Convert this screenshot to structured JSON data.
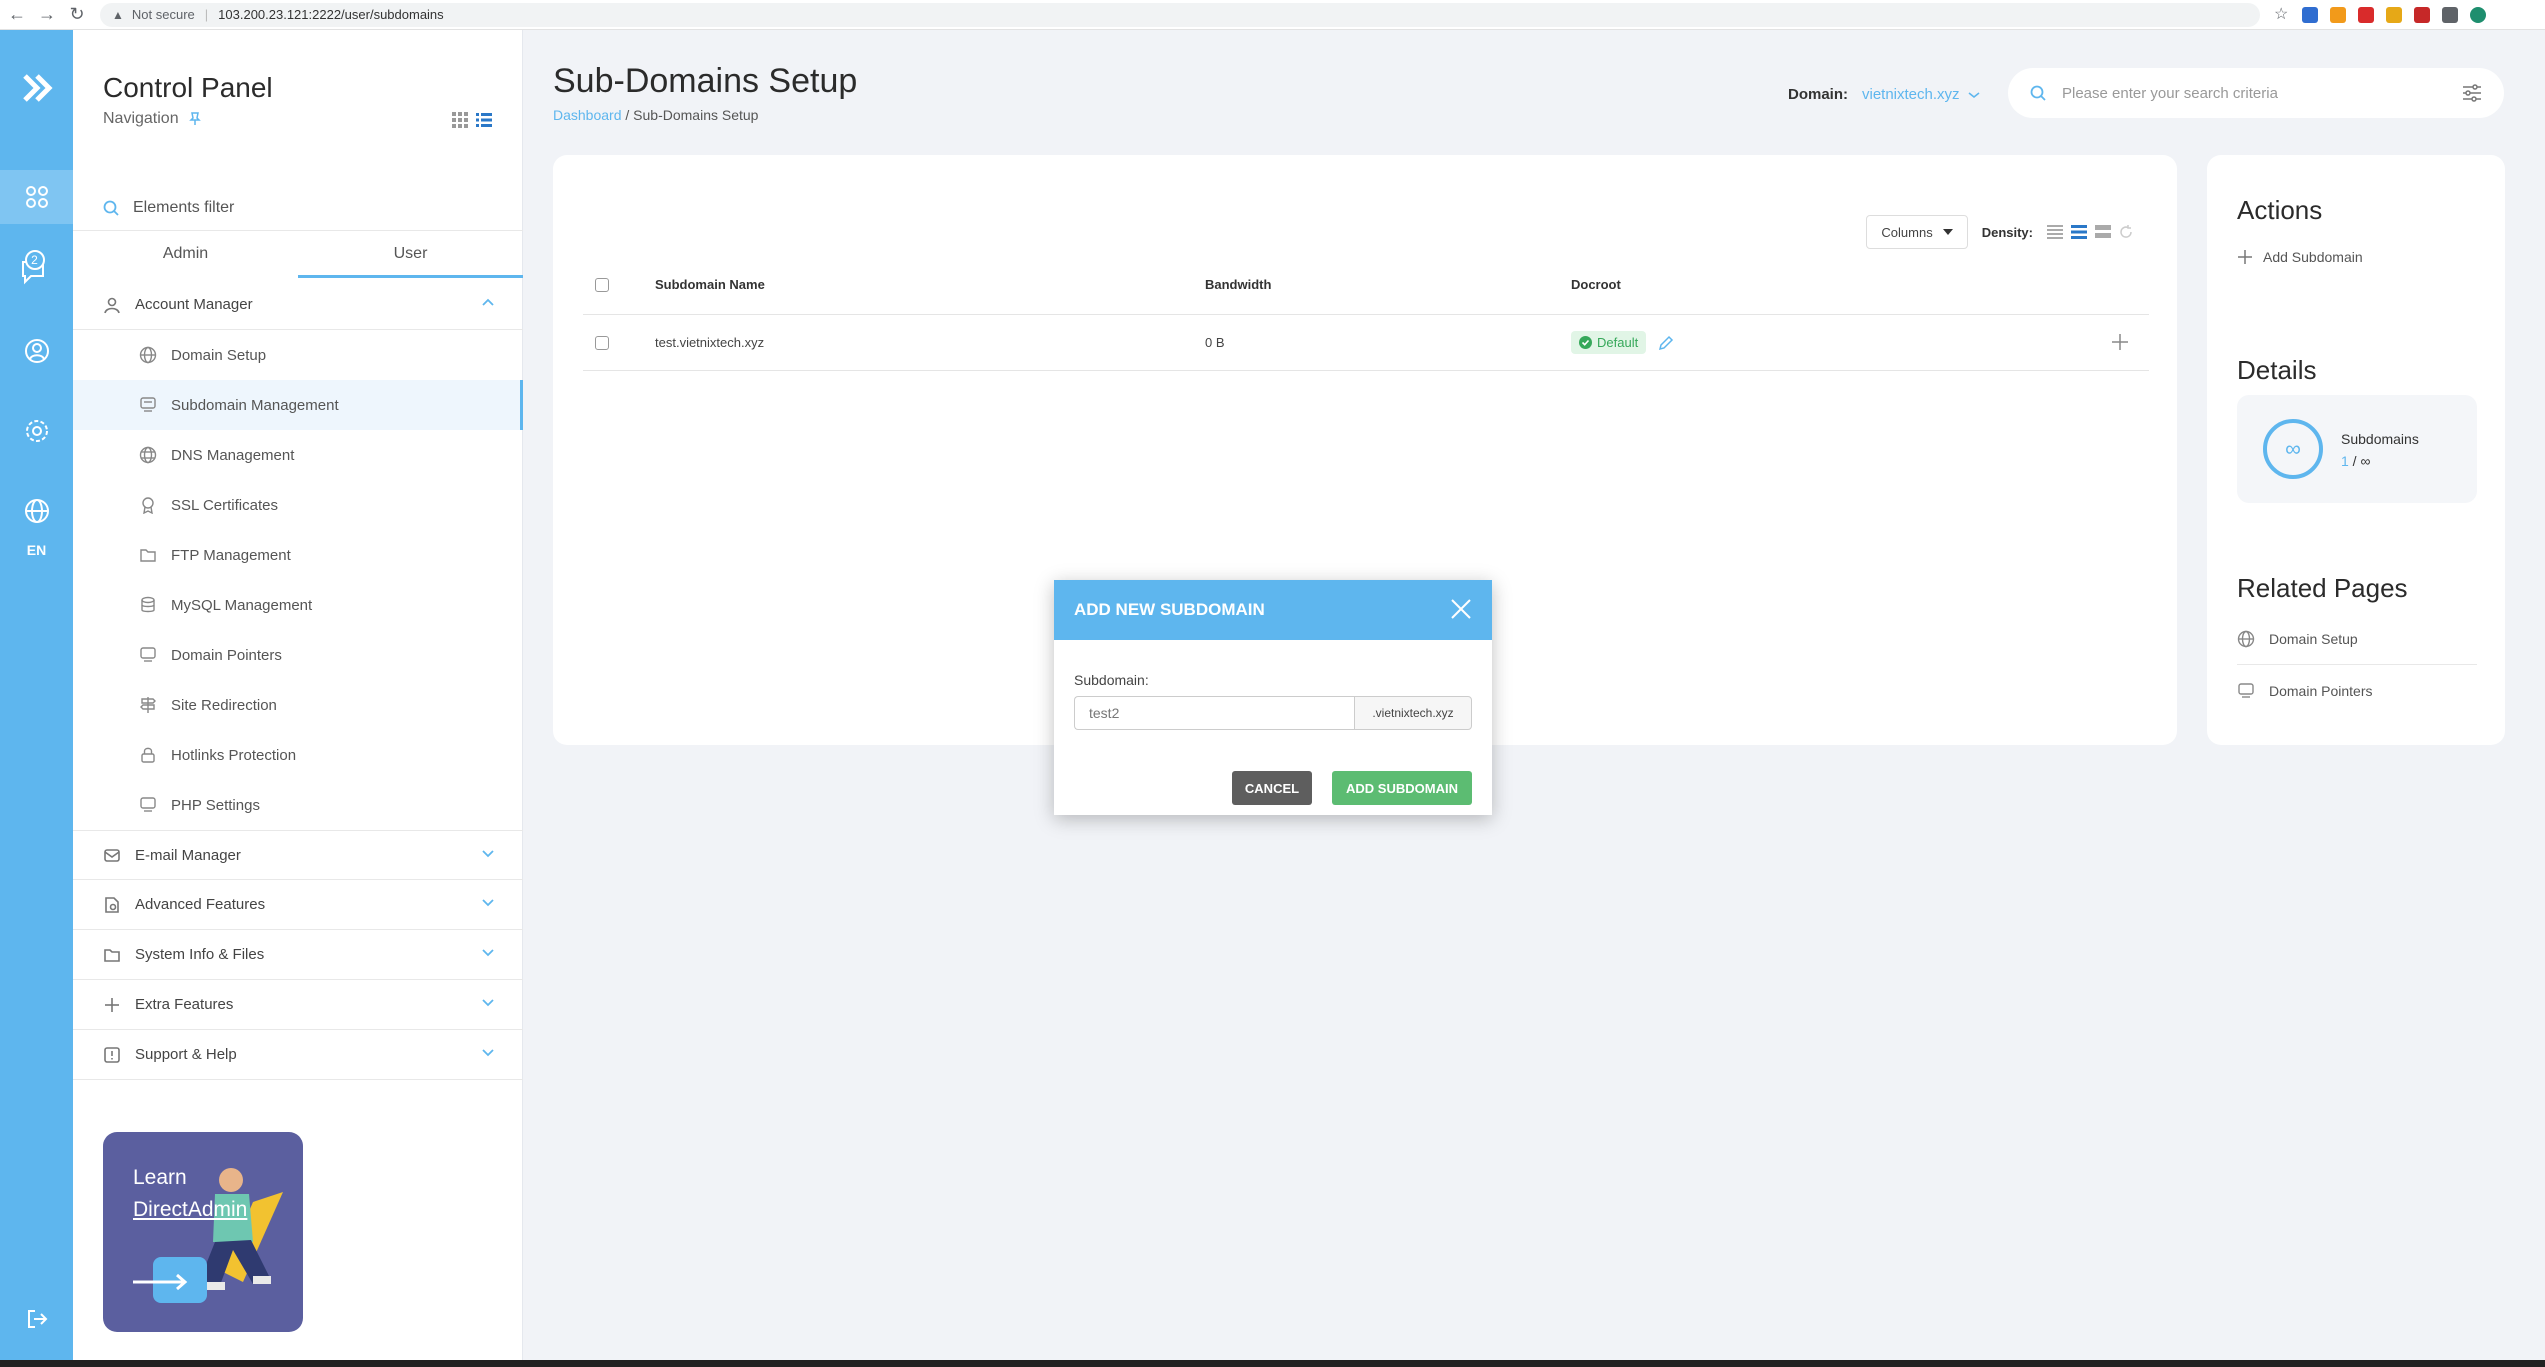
{
  "browser": {
    "security_label": "Not secure",
    "url": "103.200.23.121:2222/user/subdomains"
  },
  "rail": {
    "messages_badge": "2",
    "language": "EN"
  },
  "sidebar": {
    "title": "Control Panel",
    "subtitle": "Navigation",
    "filter_placeholder": "Elements filter",
    "tabs": [
      "Admin",
      "User"
    ],
    "account_manager": "Account Manager",
    "sub_items": [
      {
        "label": "Domain Setup",
        "icon": "globe-icon"
      },
      {
        "label": "Subdomain Management",
        "icon": "server-icon"
      },
      {
        "label": "DNS Management",
        "icon": "dns-icon"
      },
      {
        "label": "SSL Certificates",
        "icon": "certificate-icon"
      },
      {
        "label": "FTP Management",
        "icon": "folder-icon"
      },
      {
        "label": "MySQL Management",
        "icon": "database-icon"
      },
      {
        "label": "Domain Pointers",
        "icon": "pointer-icon"
      },
      {
        "label": "Site Redirection",
        "icon": "signpost-icon"
      },
      {
        "label": "Hotlinks Protection",
        "icon": "lock-icon"
      },
      {
        "label": "PHP Settings",
        "icon": "php-icon"
      }
    ],
    "groups": [
      {
        "label": "E-mail Manager",
        "icon": "mail-icon"
      },
      {
        "label": "Advanced Features",
        "icon": "advanced-icon"
      },
      {
        "label": "System Info & Files",
        "icon": "folder-icon"
      },
      {
        "label": "Extra Features",
        "icon": "plus-icon"
      },
      {
        "label": "Support & Help",
        "icon": "help-icon"
      }
    ],
    "learn": {
      "line1": "Learn",
      "line2": "DirectAdmin"
    }
  },
  "header": {
    "title": "Sub-Domains Setup",
    "breadcrumb_home": "Dashboard",
    "breadcrumb_sep": " / ",
    "breadcrumb_current": "Sub-Domains Setup",
    "domain_label": "Domain:",
    "domain_value": "vietnixtech.xyz",
    "search_placeholder": "Please enter your search criteria"
  },
  "table": {
    "columns_button": "Columns",
    "density_label": "Density:",
    "headers": [
      "Subdomain Name",
      "Bandwidth",
      "Docroot"
    ],
    "rows": [
      {
        "name": "test.vietnixtech.xyz",
        "bandwidth": "0 B",
        "docroot": "Default"
      }
    ]
  },
  "right_panel": {
    "actions_title": "Actions",
    "add_subdomain": "Add Subdomain",
    "details_title": "Details",
    "stat_label": "Subdomains",
    "stat_used": "1",
    "stat_sep": " / ",
    "stat_limit": "∞",
    "related_title": "Related Pages",
    "related": [
      "Domain Setup",
      "Domain Pointers"
    ]
  },
  "modal": {
    "title": "ADD NEW SUBDOMAIN",
    "field_label": "Subdomain:",
    "field_value": "test2",
    "suffix": ".vietnixtech.xyz",
    "cancel": "CANCEL",
    "submit": "ADD SUBDOMAIN"
  },
  "colors": {
    "accent": "#5eb6ee",
    "success": "#5cbc72",
    "dark_button": "#5e5e5e"
  }
}
